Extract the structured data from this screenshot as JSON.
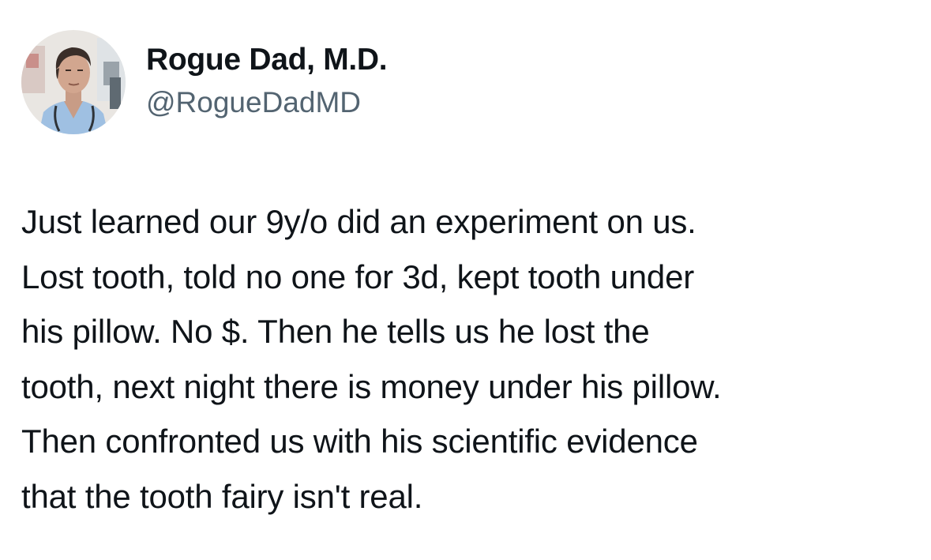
{
  "tweet": {
    "author": {
      "display_name": "Rogue Dad, M.D.",
      "handle": "@RogueDadMD",
      "avatar_icon": "profile-photo"
    },
    "text_lines": [
      "Just learned our 9y/o did an experiment on us.",
      "Lost tooth, told no one for 3d, kept tooth under",
      "his pillow.  No $.  Then he tells us he lost the",
      "tooth, next night there is money under his pillow.",
      "Then confronted us with his scientific evidence",
      "that the tooth fairy isn't real."
    ]
  },
  "colors": {
    "text_primary": "#0f1419",
    "text_secondary": "#536471",
    "background": "#ffffff"
  }
}
